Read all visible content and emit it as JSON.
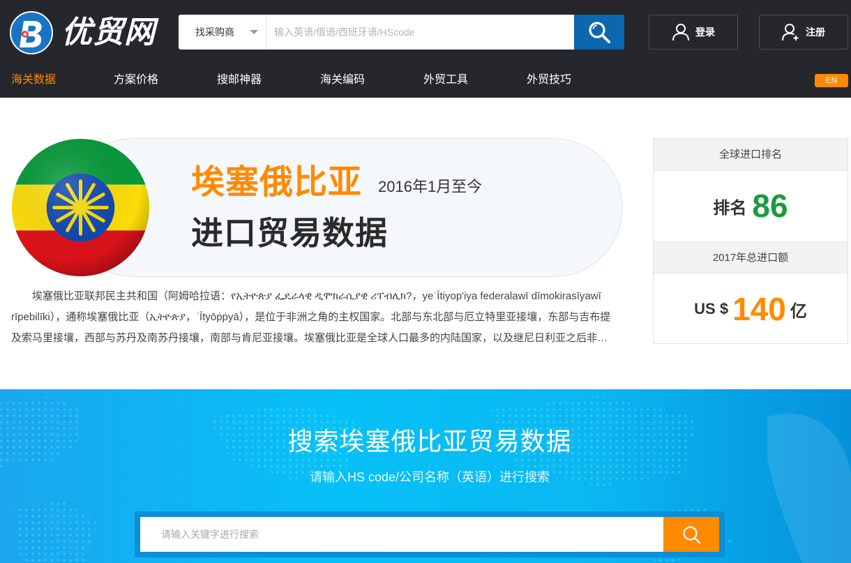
{
  "header": {
    "logo_text": "优贸网",
    "search": {
      "type_selected": "找采购商",
      "placeholder": "输入英语/俄语/西班牙语/HScode"
    },
    "login_label": "登录",
    "register_label": "注册"
  },
  "nav": {
    "items": [
      {
        "label": "海关数据",
        "active": true
      },
      {
        "label": "方案价格"
      },
      {
        "label": "搜邮神器"
      },
      {
        "label": "海关编码"
      },
      {
        "label": "外贸工具"
      },
      {
        "label": "外贸技巧"
      }
    ],
    "lang_label": "EN"
  },
  "hero": {
    "country_name": "埃塞俄比亚",
    "date_range": "2016年1月至今",
    "subtitle": "进口贸易数据",
    "intro": "埃塞俄比亚联邦民主共和国（阿姆哈拉语：የኢትዮጵያ ፌዴራላዊ ዲሞክራሲያዊ ሪፐብሊክ?，yeʾĪtiyop'iya federalawī dīmokirasīyawī rīpebilīki），通称埃塞俄比亚（ኢትዮጵያ，ʾĪtyōṗṗyā），是位于非洲之角的主权国家。北部与东北部与厄立特里亚接壤，东部与吉布提及索马里接壤，西部与苏丹及南苏丹接壤，南部与肯尼亚接壤。埃塞俄比亚是全球人口最多的内陆国家，以及继尼日利亚之后非洲人口第二多的国家。",
    "flag_colors": {
      "green": "#079a3a",
      "yellow": "#fcdd09",
      "red": "#da121a",
      "blue": "#0f47af"
    }
  },
  "stats": {
    "rank_heading": "全球进口排名",
    "rank_label": "排名",
    "rank_value": "86",
    "amount_heading": "2017年总进口额",
    "amount_prefix": "US $",
    "amount_value": "140",
    "amount_unit": "亿"
  },
  "banner": {
    "title": "搜索埃塞俄比亚贸易数据",
    "subtitle": "请输入HS code/公司名称（英语）进行搜索",
    "placeholder": "请输入关键字进行搜索"
  },
  "colors": {
    "header_bg": "#25272c",
    "accent_orange": "#ff8a00",
    "search_blue": "#0a67b0",
    "rank_green": "#1d9a41"
  }
}
